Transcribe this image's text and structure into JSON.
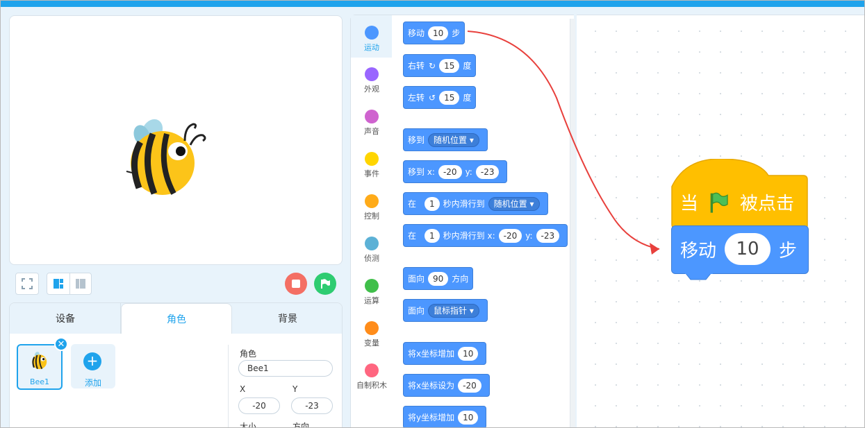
{
  "stage": {
    "controls": [
      "fullscreen-toggle",
      "layout-large",
      "layout-small"
    ],
    "stop_color": "#f46f64",
    "go_color": "#2ecc71"
  },
  "sprite_panel": {
    "tabs": [
      {
        "label": "设备"
      },
      {
        "label": "角色"
      },
      {
        "label": "背景"
      }
    ],
    "active_tab": "角色",
    "sprite_name": "Bee1",
    "close_glyph": "✕",
    "add_label": "添加",
    "add_glyph": "+",
    "props": {
      "role_label": "角色",
      "role_value": "Bee1",
      "x_label": "X",
      "y_label": "Y",
      "x_value": "-20",
      "y_value": "-23",
      "size_label": "大小",
      "dir_label": "方向"
    }
  },
  "categories": [
    {
      "label": "运动",
      "color": "#4c97ff"
    },
    {
      "label": "外观",
      "color": "#9966ff"
    },
    {
      "label": "声音",
      "color": "#cf63cf"
    },
    {
      "label": "事件",
      "color": "#ffd500"
    },
    {
      "label": "控制",
      "color": "#ffab19"
    },
    {
      "label": "侦测",
      "color": "#5cb1d6"
    },
    {
      "label": "运算",
      "color": "#40bf4a"
    },
    {
      "label": "变量",
      "color": "#ff8c1a"
    },
    {
      "label": "自制积木",
      "color": "#ff6680"
    }
  ],
  "palette": {
    "move": {
      "a": "移动",
      "v": "10",
      "b": "步"
    },
    "turn_right": {
      "a": "右转",
      "icon": "↻",
      "v": "15",
      "b": "度"
    },
    "turn_left": {
      "a": "左转",
      "icon": "↺",
      "v": "15",
      "b": "度"
    },
    "goto": {
      "a": "移到",
      "d": "随机位置 ▾"
    },
    "goto_xy": {
      "a": "移到 x:",
      "x": "-20",
      "yl": "y:",
      "y": "-23"
    },
    "glide": {
      "a": "在",
      "v": "1",
      "b": "秒内滑行到",
      "d": "随机位置 ▾"
    },
    "glide_xy": {
      "a": "在",
      "v": "1",
      "b": "秒内滑行到 x:",
      "x": "-20",
      "yl": "y:",
      "y": "-23"
    },
    "point_dir": {
      "a": "面向",
      "v": "90",
      "b": "方向"
    },
    "point_towards": {
      "a": "面向",
      "d": "鼠标指针 ▾"
    },
    "change_x": {
      "a": "将x坐标增加",
      "v": "10"
    },
    "set_x": {
      "a": "将x坐标设为",
      "v": "-20"
    },
    "change_y": {
      "a": "将y坐标增加",
      "v": "10"
    }
  },
  "script": {
    "hat_when": "当",
    "hat_clicked": "被点击",
    "move_label": "移动",
    "move_value": "10",
    "move_unit": "步"
  },
  "colors": {
    "motion": "#4c97ff",
    "events": "#ffbf00",
    "accent": "#1fa3ec",
    "arrow": "#e8403c"
  }
}
